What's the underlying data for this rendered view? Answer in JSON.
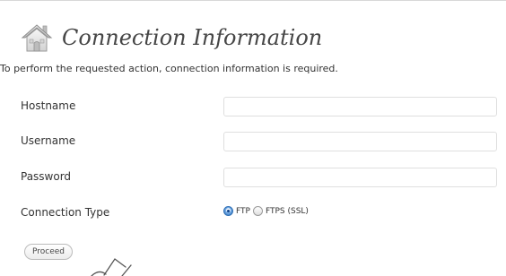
{
  "header": {
    "icon": "home-icon",
    "title": "Connection Information"
  },
  "intro_text": "To perform the requested action, connection information is required.",
  "fields": [
    {
      "label": "Hostname",
      "value": ""
    },
    {
      "label": "Username",
      "value": ""
    },
    {
      "label": "Password",
      "value": ""
    }
  ],
  "connection_type": {
    "label": "Connection Type",
    "options": [
      {
        "label": "FTP",
        "selected": true
      },
      {
        "label": "FTPS (SSL)",
        "selected": false
      }
    ]
  },
  "proceed_label": "Proceed",
  "colors": {
    "title": "#464646",
    "radio_accent": "#2e6fb5",
    "field_border": "#dfdfdf"
  }
}
